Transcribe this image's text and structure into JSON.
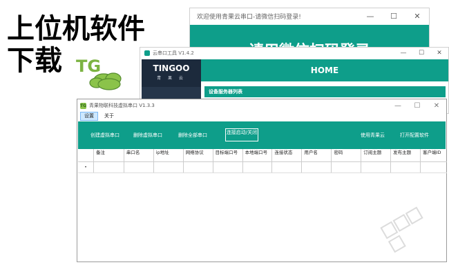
{
  "promo": {
    "line1": "上位机软件",
    "line2": "下载"
  },
  "logo": {
    "text": "TG"
  },
  "window1": {
    "title": "欢迎使用青果云串口-请微信扫码登录!",
    "banner": "请用微信扫码登录"
  },
  "window2": {
    "title": "云串口工具 V1.4.2",
    "brand_name": "TINGOO",
    "brand_sub": "青 果 云",
    "home": "HOME",
    "section": "设备服务器列表"
  },
  "window3": {
    "icon_text": "TG",
    "title": "青果物联科技虚拟串口 V1.3.3",
    "menu": [
      "设置",
      "关于"
    ],
    "toolbar": {
      "create": "创建虚拟串口",
      "delete": "删除虚拟串口",
      "delete_all": "删除全部串口",
      "connect_toggle": "连接启动/关闭",
      "use_cloud": "使用青果云",
      "open_config": "打开配置软件"
    },
    "columns": [
      "备注",
      "串口名",
      "ip地址",
      "网络协议",
      "目标端口号",
      "本地端口号",
      "连接状态",
      "用户名",
      "密码",
      "订阅主题",
      "发布主题",
      "客户端ID"
    ],
    "row_marker": "•"
  },
  "window_controls": {
    "minimize": "—",
    "maximize": "☐",
    "close": "✕"
  },
  "colors": {
    "teal": "#0e9e8a",
    "sidebar": "#26364a"
  }
}
